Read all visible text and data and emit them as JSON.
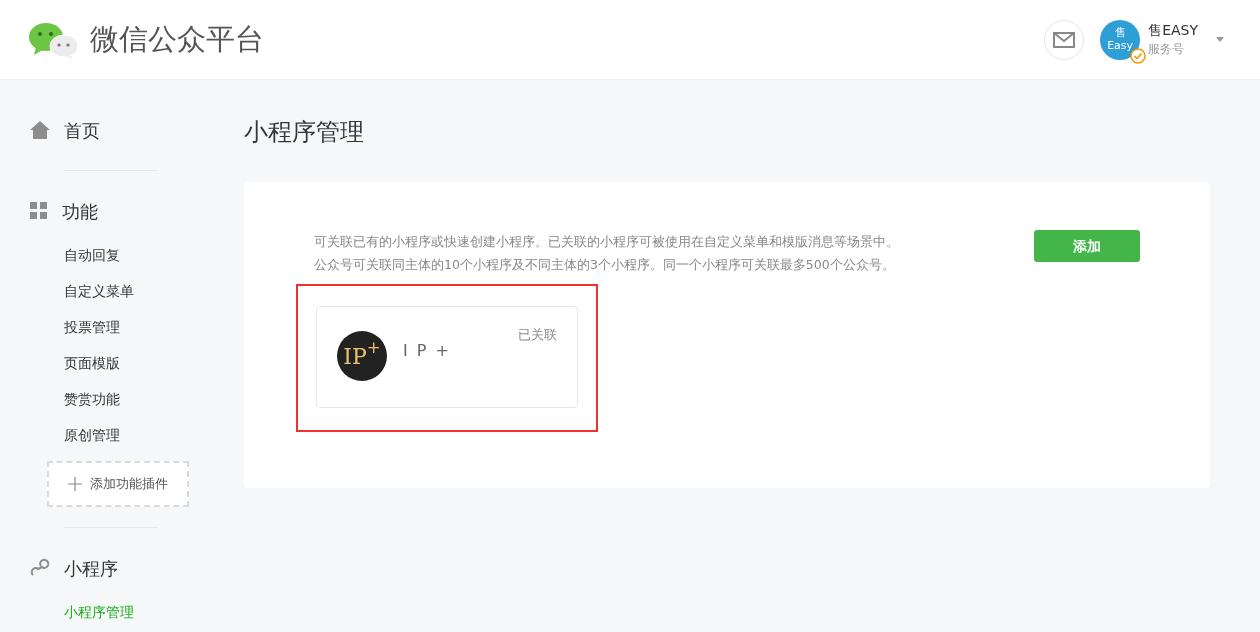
{
  "header": {
    "brand": "微信公众平台",
    "account": {
      "avatar_lines": [
        "售",
        "Easy"
      ],
      "verified": true,
      "name": "售EASY",
      "type": "服务号"
    }
  },
  "sidebar": {
    "sections": [
      {
        "kind": "home",
        "label": "首页"
      },
      {
        "kind": "grid",
        "label": "功能",
        "items": [
          {
            "label": "自动回复",
            "selected": false
          },
          {
            "label": "自定义菜单",
            "selected": false
          },
          {
            "label": "投票管理",
            "selected": false
          },
          {
            "label": "页面模版",
            "selected": false
          },
          {
            "label": "赞赏功能",
            "selected": false
          },
          {
            "label": "原创管理",
            "selected": false
          }
        ],
        "add_plugin": "添加功能插件"
      },
      {
        "kind": "link",
        "label": "小程序",
        "items": [
          {
            "label": "小程序管理",
            "selected": true
          }
        ]
      }
    ]
  },
  "page": {
    "title": "小程序管理",
    "description": [
      "可关联已有的小程序或快速创建小程序。已关联的小程序可被使用在自定义菜单和模版消息等场景中。",
      "公众号可关联同主体的10个小程序及不同主体的3个小程序。同一个小程序可关联最多500个公众号。"
    ],
    "add_button": "添加",
    "apps": [
      {
        "logo_text": "IP",
        "logo_sup": "+",
        "name": "I P +",
        "status": "已关联",
        "highlighted": true
      }
    ]
  }
}
